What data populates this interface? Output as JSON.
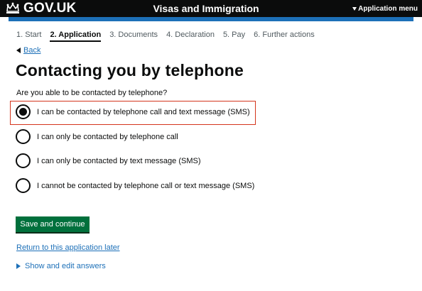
{
  "header": {
    "logo_text": "GOV.UK",
    "service_name": "Visas and Immigration",
    "menu_label": "Application menu"
  },
  "steps": [
    {
      "label": "1. Start",
      "current": false
    },
    {
      "label": "2. Application",
      "current": true
    },
    {
      "label": "3. Documents",
      "current": false
    },
    {
      "label": "4. Declaration",
      "current": false
    },
    {
      "label": "5. Pay",
      "current": false
    },
    {
      "label": "6. Further actions",
      "current": false
    }
  ],
  "back_label": "Back",
  "page_title": "Contacting you by telephone",
  "question": "Are you able to be contacted by telephone?",
  "options": [
    {
      "label": "I can be contacted by telephone call and text message (SMS)",
      "selected": true
    },
    {
      "label": "I can only be contacted by telephone call",
      "selected": false
    },
    {
      "label": "I can only be contacted by text message (SMS)",
      "selected": false
    },
    {
      "label": "I cannot be contacted by telephone call or text message (SMS)",
      "selected": false
    }
  ],
  "save_button": "Save and continue",
  "return_link": "Return to this application later",
  "show_edit": "Show and edit answers",
  "colors": {
    "header_bg": "#0b0c0c",
    "header_accent": "#1d70b8",
    "link": "#1d70b8",
    "button": "#00703c",
    "highlight": "#d4351c"
  }
}
